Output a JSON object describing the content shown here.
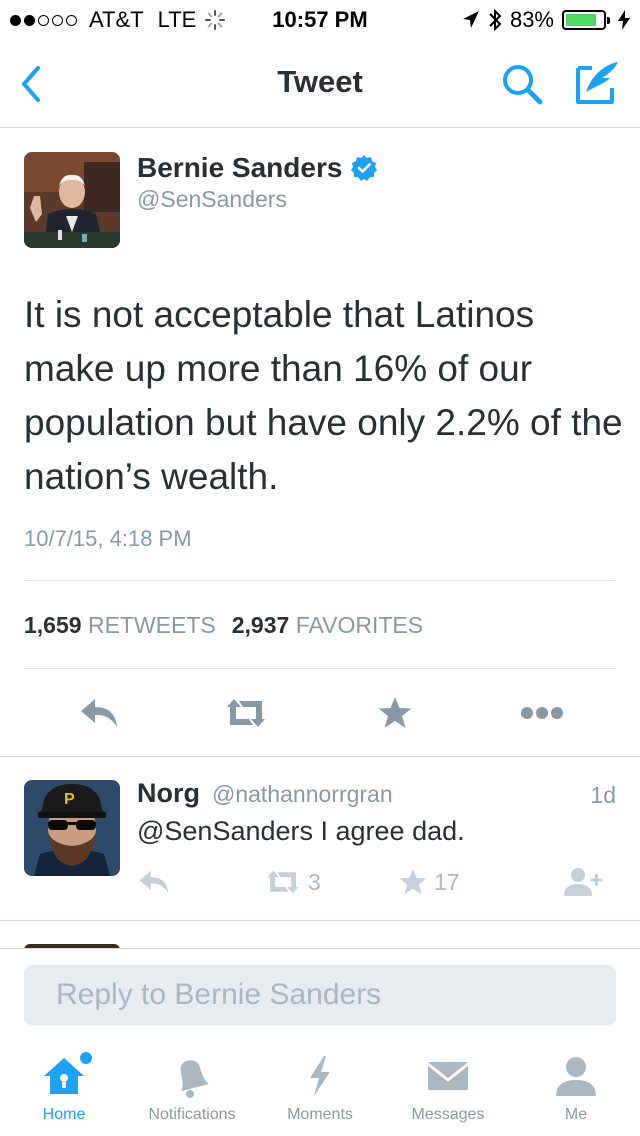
{
  "status_bar": {
    "carrier": "AT&T",
    "network": "LTE",
    "time": "10:57 PM",
    "battery": "83%",
    "battery_level": 0.83
  },
  "nav": {
    "title": "Tweet",
    "back_icon": "chevron-left-icon",
    "search_icon": "search-icon",
    "compose_icon": "compose-icon"
  },
  "tweet": {
    "author_name": "Bernie Sanders",
    "author_handle": "@SenSanders",
    "text": "It is not acceptable that Latinos make up more than 16% of our population but have only 2.2% of the nation’s wealth.",
    "timestamp": "10/7/15, 4:18 PM",
    "retweet_count": "1,659",
    "retweet_label": "RETWEETS",
    "favorite_count": "2,937",
    "favorite_label": "FAVORITES"
  },
  "reply": {
    "name": "Norg",
    "handle": "@nathannorrgran",
    "age": "1d",
    "text": "@SenSanders I agree dad.",
    "retweets": "3",
    "favorites": "17"
  },
  "composer": {
    "placeholder": "Reply to Bernie Sanders"
  },
  "tabs": [
    {
      "label": "Home",
      "active": true
    },
    {
      "label": "Notifications"
    },
    {
      "label": "Moments"
    },
    {
      "label": "Messages"
    },
    {
      "label": "Me"
    }
  ],
  "colors": {
    "accent": "#1da1f2",
    "muted": "#8899a6",
    "text": "#292f33"
  }
}
